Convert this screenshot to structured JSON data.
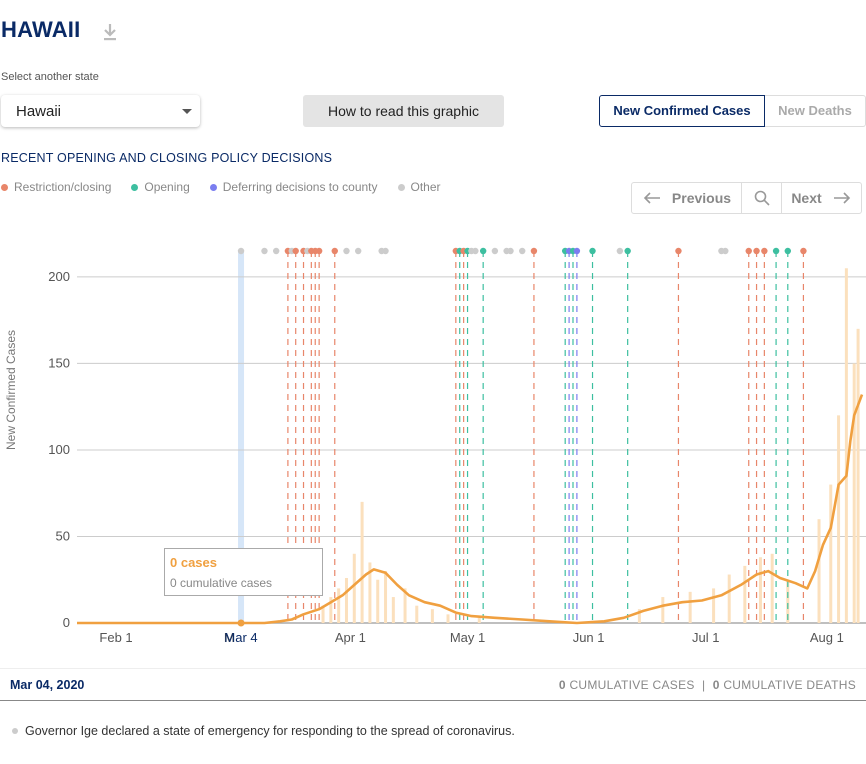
{
  "header": {
    "title": "HAWAII"
  },
  "controls": {
    "select_label": "Select another state",
    "selected_state": "Hawaii",
    "how_to_read": "How to read this graphic",
    "metric_active": "New Confirmed Cases",
    "metric_inactive": "New Deaths"
  },
  "policy": {
    "heading": "RECENT OPENING AND CLOSING POLICY DECISIONS",
    "legend": [
      {
        "label": "Restriction/closing",
        "color": "#e8866a"
      },
      {
        "label": "Opening",
        "color": "#3dbfa0"
      },
      {
        "label": "Deferring decisions to county",
        "color": "#7b7ef0"
      },
      {
        "label": "Other",
        "color": "#cccccc"
      }
    ]
  },
  "nav": {
    "previous": "Previous",
    "next": "Next"
  },
  "tooltip": {
    "cases": "0 cases",
    "cumulative": "0 cumulative cases"
  },
  "footer": {
    "date": "Mar 04, 2020",
    "cumulative_cases_value": "0",
    "cumulative_cases_label": "CUMULATIVE CASES",
    "separator": "|",
    "cumulative_deaths_value": "0",
    "cumulative_deaths_label": "CUMULATIVE DEATHS"
  },
  "event": {
    "text": "Governor Ige declared a state of emergency for responding to the spread of coronavirus."
  },
  "chart_data": {
    "type": "line",
    "ylabel": "New Confirmed Cases",
    "ylim": [
      0,
      230
    ],
    "yticks": [
      0,
      50,
      100,
      150,
      200
    ],
    "x_start": "2020-01-22",
    "x_end": "2020-08-10",
    "xticks": [
      {
        "label": "Feb 1",
        "date": "2020-02-01"
      },
      {
        "label": "M",
        "date": "2020-03-01"
      },
      {
        "label": "Apr 1",
        "date": "2020-04-01"
      },
      {
        "label": "May 1",
        "date": "2020-05-01"
      },
      {
        "label": "Jun 1",
        "date": "2020-06-01"
      },
      {
        "label": "Jul 1",
        "date": "2020-07-01"
      },
      {
        "label": "Aug 1",
        "date": "2020-08-01"
      }
    ],
    "highlight": {
      "label": "Mar 4",
      "date": "2020-03-04"
    },
    "series": [
      {
        "color": "#f0a040",
        "points": [
          [
            "2020-01-22",
            0
          ],
          [
            "2020-03-10",
            0
          ],
          [
            "2020-03-14",
            1
          ],
          [
            "2020-03-17",
            2
          ],
          [
            "2020-03-20",
            5
          ],
          [
            "2020-03-24",
            8
          ],
          [
            "2020-03-27",
            12
          ],
          [
            "2020-03-30",
            16
          ],
          [
            "2020-04-02",
            22
          ],
          [
            "2020-04-05",
            28
          ],
          [
            "2020-04-07",
            31
          ],
          [
            "2020-04-10",
            29
          ],
          [
            "2020-04-13",
            22
          ],
          [
            "2020-04-16",
            16
          ],
          [
            "2020-04-20",
            12
          ],
          [
            "2020-04-24",
            10
          ],
          [
            "2020-04-28",
            6
          ],
          [
            "2020-05-02",
            4
          ],
          [
            "2020-05-08",
            3
          ],
          [
            "2020-05-15",
            2
          ],
          [
            "2020-05-22",
            1
          ],
          [
            "2020-05-29",
            0
          ],
          [
            "2020-06-05",
            1
          ],
          [
            "2020-06-10",
            3
          ],
          [
            "2020-06-15",
            7
          ],
          [
            "2020-06-20",
            10
          ],
          [
            "2020-06-25",
            12
          ],
          [
            "2020-06-30",
            13
          ],
          [
            "2020-07-05",
            16
          ],
          [
            "2020-07-10",
            22
          ],
          [
            "2020-07-14",
            28
          ],
          [
            "2020-07-17",
            30
          ],
          [
            "2020-07-20",
            26
          ],
          [
            "2020-07-24",
            23
          ],
          [
            "2020-07-27",
            20
          ],
          [
            "2020-07-29",
            30
          ],
          [
            "2020-07-31",
            45
          ],
          [
            "2020-08-02",
            55
          ],
          [
            "2020-08-04",
            80
          ],
          [
            "2020-08-06",
            85
          ],
          [
            "2020-08-07",
            105
          ],
          [
            "2020-08-08",
            120
          ],
          [
            "2020-08-10",
            132
          ]
        ]
      },
      {
        "color": "#fbe0bd",
        "bars": [
          [
            "2020-03-25",
            10
          ],
          [
            "2020-03-27",
            15
          ],
          [
            "2020-03-29",
            20
          ],
          [
            "2020-03-31",
            26
          ],
          [
            "2020-04-02",
            40
          ],
          [
            "2020-04-04",
            70
          ],
          [
            "2020-04-06",
            35
          ],
          [
            "2020-04-08",
            25
          ],
          [
            "2020-04-10",
            30
          ],
          [
            "2020-04-12",
            15
          ],
          [
            "2020-04-15",
            20
          ],
          [
            "2020-04-18",
            10
          ],
          [
            "2020-04-22",
            8
          ],
          [
            "2020-04-26",
            5
          ],
          [
            "2020-05-04",
            3
          ],
          [
            "2020-06-14",
            8
          ],
          [
            "2020-06-20",
            15
          ],
          [
            "2020-06-27",
            18
          ],
          [
            "2020-07-03",
            20
          ],
          [
            "2020-07-07",
            28
          ],
          [
            "2020-07-11",
            33
          ],
          [
            "2020-07-15",
            38
          ],
          [
            "2020-07-18",
            40
          ],
          [
            "2020-07-22",
            25
          ],
          [
            "2020-07-30",
            60
          ],
          [
            "2020-08-02",
            80
          ],
          [
            "2020-08-04",
            120
          ],
          [
            "2020-08-06",
            205
          ],
          [
            "2020-08-08",
            150
          ],
          [
            "2020-08-09",
            170
          ]
        ]
      }
    ],
    "events": [
      [
        "2020-03-04",
        "other"
      ],
      [
        "2020-03-10",
        "other"
      ],
      [
        "2020-03-13",
        "other"
      ],
      [
        "2020-03-16",
        "restriction"
      ],
      [
        "2020-03-17",
        "other"
      ],
      [
        "2020-03-18",
        "restriction"
      ],
      [
        "2020-03-20",
        "restriction"
      ],
      [
        "2020-03-21",
        "other"
      ],
      [
        "2020-03-22",
        "restriction"
      ],
      [
        "2020-03-23",
        "restriction"
      ],
      [
        "2020-03-24",
        "restriction"
      ],
      [
        "2020-03-28",
        "restriction"
      ],
      [
        "2020-03-31",
        "other"
      ],
      [
        "2020-04-03",
        "other"
      ],
      [
        "2020-04-09",
        "other"
      ],
      [
        "2020-04-10",
        "other"
      ],
      [
        "2020-04-28",
        "restriction"
      ],
      [
        "2020-04-29",
        "opening"
      ],
      [
        "2020-04-30",
        "restriction"
      ],
      [
        "2020-05-01",
        "opening"
      ],
      [
        "2020-05-02",
        "other"
      ],
      [
        "2020-05-03",
        "other"
      ],
      [
        "2020-05-05",
        "opening"
      ],
      [
        "2020-05-08",
        "other"
      ],
      [
        "2020-05-11",
        "other"
      ],
      [
        "2020-05-12",
        "other"
      ],
      [
        "2020-05-15",
        "other"
      ],
      [
        "2020-05-18",
        "restriction"
      ],
      [
        "2020-05-26",
        "opening"
      ],
      [
        "2020-05-27",
        "deferring"
      ],
      [
        "2020-05-28",
        "opening"
      ],
      [
        "2020-05-29",
        "deferring"
      ],
      [
        "2020-06-02",
        "opening"
      ],
      [
        "2020-06-09",
        "other"
      ],
      [
        "2020-06-11",
        "opening"
      ],
      [
        "2020-06-24",
        "restriction"
      ],
      [
        "2020-07-05",
        "other"
      ],
      [
        "2020-07-06",
        "other"
      ],
      [
        "2020-07-12",
        "restriction"
      ],
      [
        "2020-07-14",
        "restriction"
      ],
      [
        "2020-07-16",
        "restriction"
      ],
      [
        "2020-07-19",
        "opening"
      ],
      [
        "2020-07-22",
        "opening"
      ],
      [
        "2020-07-26",
        "restriction"
      ]
    ]
  }
}
